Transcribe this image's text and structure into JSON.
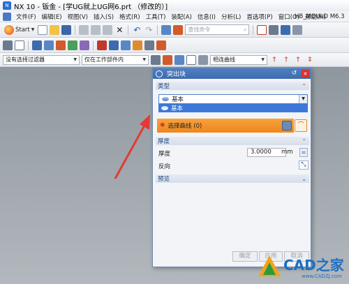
{
  "window": {
    "title": "NX 10 - 钣金 - [学UG就上UG网6.prt （修改的）]"
  },
  "menubar": {
    "items": [
      "文件(F)",
      "编辑(E)",
      "视图(V)",
      "插入(S)",
      "格式(R)",
      "工具(T)",
      "装配(A)",
      "信息(I)",
      "分析(L)",
      "首选项(P)",
      "窗口(O)",
      "帮助(H)"
    ],
    "brand": "HB_MOULD M6.3"
  },
  "toolbar": {
    "start_label": "Start",
    "search_placeholder": "查找命令"
  },
  "filter_bar": {
    "selection_filter": "没有选择过滤器",
    "scope": "仅在工作部件内",
    "curve_rule": "相连曲线"
  },
  "dialog": {
    "title": "突出块",
    "close_label": "×",
    "reset_label": "↺",
    "type_section": "类型",
    "type_value": "基本",
    "type_option": "基本",
    "curve_section_label": "选择曲线 (0)",
    "thickness_section": "厚度",
    "thickness_label": "厚度",
    "thickness_value": "3.0000",
    "thickness_unit": "mm",
    "reverse_label": "反向",
    "preview_section": "预览",
    "ok_label": "确定",
    "apply_label": "应用",
    "cancel_label": "取消"
  },
  "watermark": {
    "text": "CAD之家",
    "url": "www.CADZJ.com"
  },
  "colors": {
    "accent_blue": "#3d78d8",
    "selection_orange": "#f0861c",
    "arrow_red": "#e53935"
  }
}
